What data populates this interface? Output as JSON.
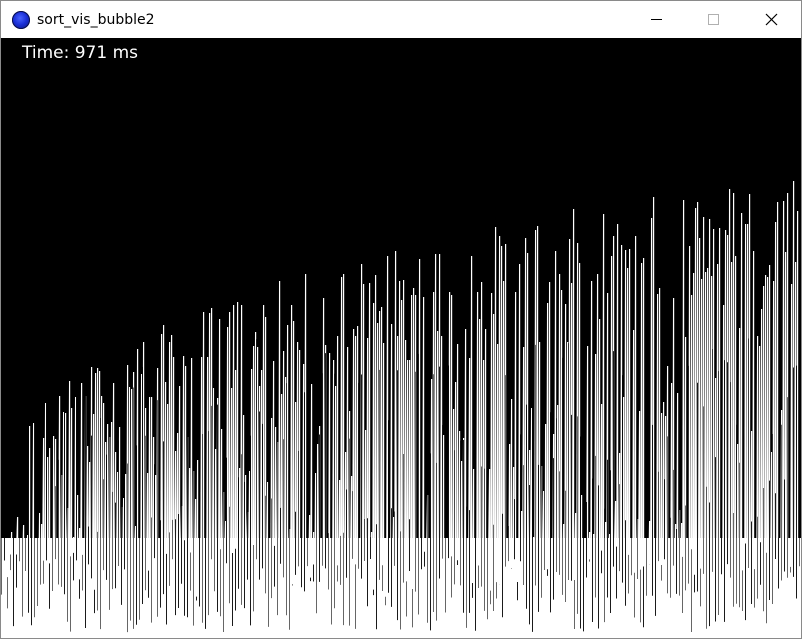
{
  "window": {
    "title": "sort_vis_bubble2",
    "icon": "app-globe-icon",
    "controls": [
      "minimize-icon",
      "maximize-icon",
      "close-icon"
    ]
  },
  "canvas": {
    "background": "#000000",
    "bar_color": "#ffffff",
    "time_label": "Time: 971 ms"
  }
}
